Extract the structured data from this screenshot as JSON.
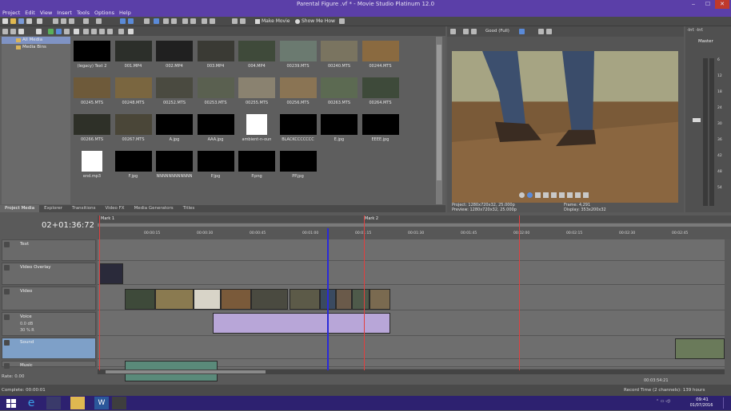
{
  "window": {
    "title": "Parental Figure .vf * - Movie Studio Platinum 12.0"
  },
  "menu": [
    "Project",
    "Edit",
    "View",
    "Insert",
    "Tools",
    "Options",
    "Help"
  ],
  "toolbar": {
    "make_movie": "Make Movie",
    "show_me_how": "Show Me How"
  },
  "media_tree": [
    "All Media",
    "Media Bins"
  ],
  "media_items": [
    {
      "name": "(legacy) Text 2",
      "color": "#000000"
    },
    {
      "name": "001.MP4",
      "color": "#2c2f2a"
    },
    {
      "name": "002.MP4",
      "color": "#202020"
    },
    {
      "name": "003.MP4",
      "color": "#3a3a34"
    },
    {
      "name": "004.MP4",
      "color": "#3f4a3a"
    },
    {
      "name": "00239.MTS",
      "color": "#6b7a70"
    },
    {
      "name": "00240.MTS",
      "color": "#7a7460"
    },
    {
      "name": "00244.MTS",
      "color": "#8a6a40"
    },
    {
      "name": "00245.MTS",
      "color": "#6e5a3a"
    },
    {
      "name": "00248.MTS",
      "color": "#7a6640"
    },
    {
      "name": "00252.MTS",
      "color": "#4a4a40"
    },
    {
      "name": "00253.MTS",
      "color": "#5a6050"
    },
    {
      "name": "00255.MTS",
      "color": "#8a8270"
    },
    {
      "name": "00256.MTS",
      "color": "#8a7454"
    },
    {
      "name": "00263.MTS",
      "color": "#5c6a52"
    },
    {
      "name": "00264.MTS",
      "color": "#3e4a3a"
    },
    {
      "name": "00266.MTS",
      "color": "#2e3028"
    },
    {
      "name": "00267.MTS",
      "color": "#4a4638"
    },
    {
      "name": "A.jpg",
      "color": "#000000"
    },
    {
      "name": "AAA.jpg",
      "color": "#000000"
    },
    {
      "name": "ambient-n-oun",
      "color": "#ffffff"
    },
    {
      "name": "BLACKCCCCCCC",
      "color": "#000000"
    },
    {
      "name": "E.jpg",
      "color": "#000000"
    },
    {
      "name": "EEEE.jpg",
      "color": "#000000"
    },
    {
      "name": "end.mp3",
      "color": "#ffffff"
    },
    {
      "name": "F.jpg",
      "color": "#000000"
    },
    {
      "name": "NNNNNNNNNNNN",
      "color": "#000000"
    },
    {
      "name": "P.jpg",
      "color": "#000000"
    },
    {
      "name": "P.png",
      "color": "#000000"
    },
    {
      "name": "PP.jpg",
      "color": "#000000"
    }
  ],
  "media_tabs": [
    "Project Media",
    "Explorer",
    "Transitions",
    "Video FX",
    "Media Generators",
    "Titles"
  ],
  "preview": {
    "quality": "Good (Full)",
    "project_label": "Project:",
    "project_value": "1280x720x32, 25.000p",
    "preview_label": "Preview:",
    "preview_value": "1280x720x32, 25.000p",
    "frame_label": "Frame:",
    "frame_value": "4,291",
    "display_label": "Display:",
    "display_value": "353x200x32"
  },
  "master": {
    "label": "Master",
    "scale": "-Inf. -Inf.",
    "db": [
      "6",
      "12",
      "18",
      "24",
      "30",
      "36",
      "42",
      "48",
      "54"
    ]
  },
  "timeline": {
    "time": "02+01:36:72",
    "markers": [
      "Mark 1",
      "Mark 2"
    ],
    "ruler": [
      "00:00:15",
      "00:00:30",
      "00:00:45",
      "00:01:00",
      "00:01:15",
      "00:01:30",
      "00:01:45",
      "00:02:00",
      "00:02:15",
      "00:02:30",
      "00:02:45"
    ],
    "tracks": [
      {
        "name": "Text",
        "type": "video"
      },
      {
        "name": "Video Overlay",
        "type": "video"
      },
      {
        "name": "Video",
        "type": "video"
      },
      {
        "name": "Voice",
        "type": "audio",
        "vol": "0.0 dB",
        "pan": "30 % R"
      },
      {
        "name": "Sound",
        "type": "audio"
      },
      {
        "name": "Music",
        "type": "audio"
      }
    ],
    "rate": "Rate: 0.00"
  },
  "status": {
    "complete": "Complete: 00:00:01",
    "record_time": "Record Time (2 channels): 139 hours",
    "end": "00:03:54:21"
  },
  "taskbar": {
    "time": "09:41",
    "date": "01/07/2016"
  }
}
